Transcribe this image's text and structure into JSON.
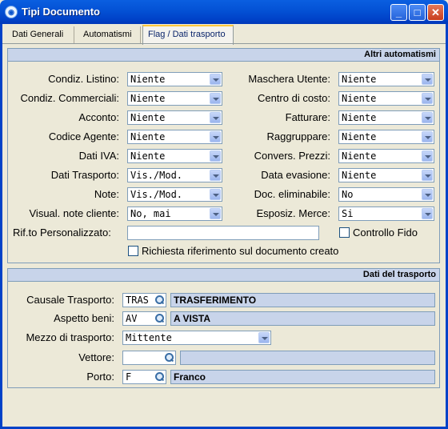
{
  "window": {
    "title": "Tipi Documento",
    "icon": "app-icon"
  },
  "tabs": [
    {
      "label": "Dati Generali"
    },
    {
      "label": "Automatismi"
    },
    {
      "label": "Flag / Dati trasporto"
    }
  ],
  "altri_automatismi": {
    "header": "Altri automatismi",
    "left": [
      {
        "label": "Condiz. Listino:",
        "value": "Niente"
      },
      {
        "label": "Condiz. Commerciali:",
        "value": "Niente"
      },
      {
        "label": "Acconto:",
        "value": "Niente"
      },
      {
        "label": "Codice Agente:",
        "value": "Niente"
      },
      {
        "label": "Dati IVA:",
        "value": "Niente"
      },
      {
        "label": "Dati Trasporto:",
        "value": "Vis./Mod."
      },
      {
        "label": "Note:",
        "value": "Vis./Mod."
      },
      {
        "label": "Visual. note cliente:",
        "value": "No, mai"
      }
    ],
    "right": [
      {
        "label": "Maschera Utente:",
        "value": "Niente"
      },
      {
        "label": "Centro di costo:",
        "value": "Niente"
      },
      {
        "label": "Fatturare:",
        "value": "Niente"
      },
      {
        "label": "Raggruppare:",
        "value": "Niente"
      },
      {
        "label": "Convers. Prezzi:",
        "value": "Niente"
      },
      {
        "label": "Data evasione:",
        "value": "Niente"
      },
      {
        "label": "Doc. eliminabile:",
        "value": "No"
      },
      {
        "label": "Esposiz. Merce:",
        "value": "Si"
      }
    ],
    "rif_personalizzato": {
      "label": "Rif.to Personalizzato:",
      "value": ""
    },
    "controllo_fido": {
      "label": "Controllo Fido",
      "checked": false
    },
    "richiesta_riferimento": {
      "label": "Richiesta riferimento sul documento creato",
      "checked": false
    }
  },
  "dati_trasporto": {
    "header": "Dati del trasporto",
    "causale": {
      "label": "Causale Trasporto:",
      "code": "TRAS",
      "description": "TRASFERIMENTO"
    },
    "aspetto": {
      "label": "Aspetto beni:",
      "code": "AV",
      "description": "A VISTA"
    },
    "mezzo": {
      "label": "Mezzo di trasporto:",
      "value": "Mittente"
    },
    "vettore": {
      "label": "Vettore:",
      "code": "",
      "description": ""
    },
    "porto": {
      "label": "Porto:",
      "code": "F",
      "description": "Franco"
    }
  },
  "colors": {
    "titlebar": "#0453D6",
    "section_header": "#C8D4EA",
    "window_bg": "#ECE9D8"
  }
}
